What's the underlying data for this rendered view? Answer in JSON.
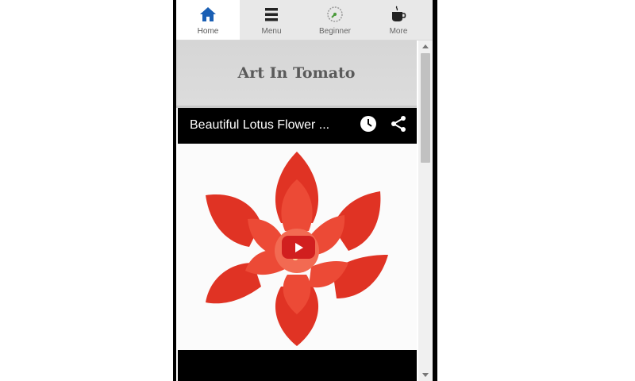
{
  "tabs": [
    {
      "label": "Home",
      "icon": "home-icon",
      "active": true
    },
    {
      "label": "Menu",
      "icon": "menu-icon",
      "active": false
    },
    {
      "label": "Beginner",
      "icon": "gauge-icon",
      "active": false
    },
    {
      "label": "More",
      "icon": "coffee-cup-icon",
      "active": false
    }
  ],
  "page": {
    "title": "Art In Tomato"
  },
  "video": {
    "title": "Beautiful Lotus Flower ...",
    "actions": [
      "watch-later-icon",
      "share-icon"
    ]
  },
  "colors": {
    "accent": "#1a5fb4",
    "play_button": "#d11f1f",
    "tomato": "#e8372a"
  }
}
